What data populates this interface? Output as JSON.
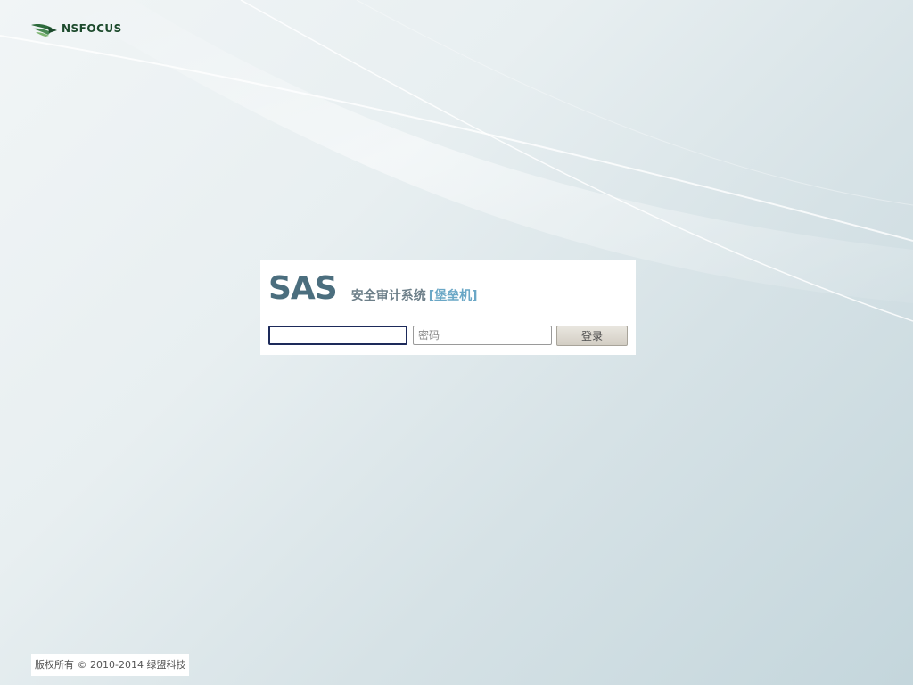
{
  "header": {
    "logo_text": "NSFOCUS",
    "logo_icon": "nsfocus-wing-icon"
  },
  "login": {
    "brand_name": "SAS",
    "system_title": "安全审计系统",
    "system_subtitle": "[堡垒机]",
    "username_value": "",
    "password_placeholder": "密码",
    "login_label": "登录"
  },
  "footer": {
    "copyright": "版权所有 © 2010-2014 绿盟科技"
  },
  "colors": {
    "brand": "#4b6e7e",
    "accent": "#6aa7c6",
    "logo": "#1c4a2c"
  }
}
